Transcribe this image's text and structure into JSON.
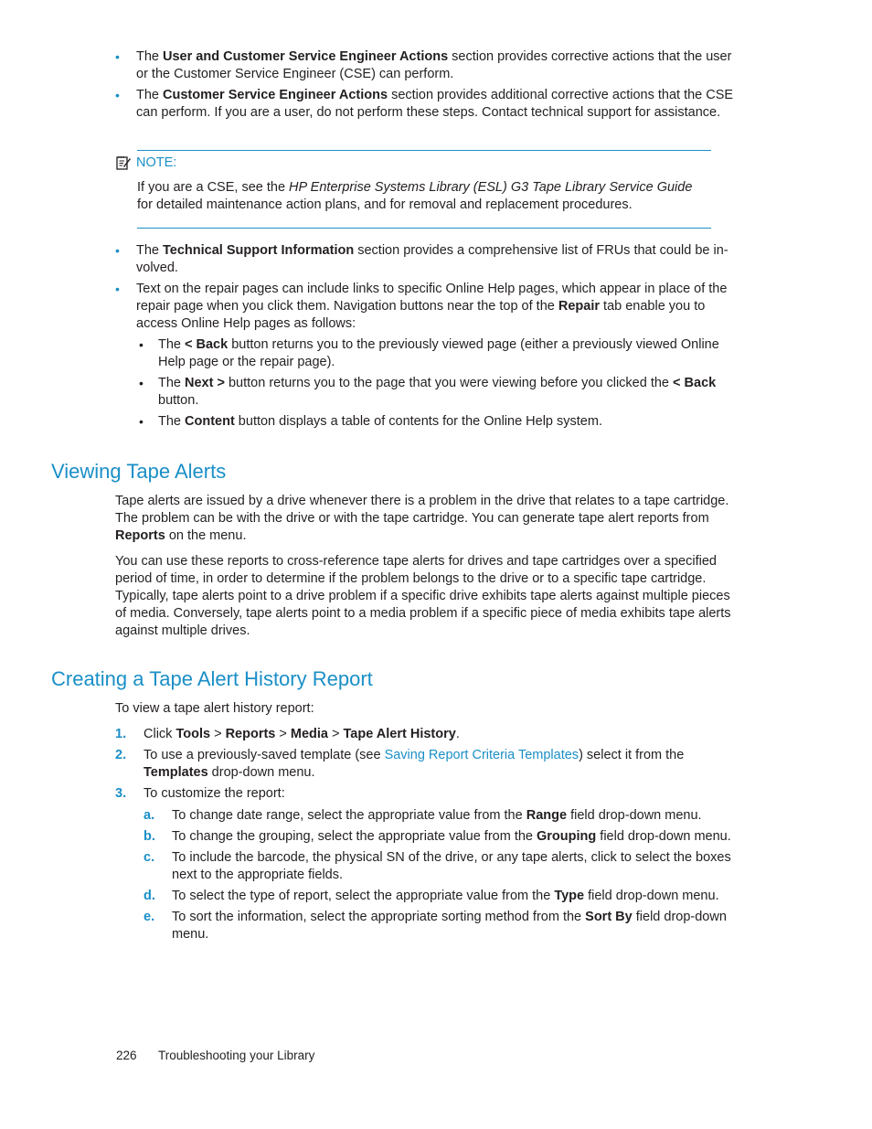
{
  "top_bullets": [
    {
      "pre": "The ",
      "bold": "User and Customer Service Engineer Actions",
      "post": " section provides corrective actions that the user or the Customer Service Engineer (CSE) can perform."
    },
    {
      "pre": "The ",
      "bold": "Customer Service Engineer Actions",
      "post": " section provides additional corrective actions that the CSE can perform. If you are a user, do not perform these steps. Contact technical support for assistance."
    }
  ],
  "note": {
    "icon": "note-pad-icon",
    "label": "NOTE:",
    "pre": "If you are a CSE, see the ",
    "italic": "HP Enterprise Systems Library (ESL) G3 Tape Library Service Guide",
    "post": " for detailed maintenance action plans, and for removal and replacement procedures."
  },
  "mid_bullets": {
    "tech_support": {
      "pre": "The ",
      "bold": "Technical Support Information",
      "post": " section provides a comprehensive list of FRUs that could be in-volved."
    },
    "repair_pages": {
      "pre": "Text on the repair pages can include links to specific Online Help pages, which appear in place of the repair page when you click them. Navigation buttons near the top of the ",
      "bold": "Repair",
      "post": " tab enable you to access Online Help pages as follows:"
    },
    "nav_buttons": [
      {
        "pre": "The ",
        "bold": "< Back",
        "post": " button returns you to the previously viewed page (either a previously viewed Online Help page or the repair page).",
        "bold2": "",
        "post2": ""
      },
      {
        "pre": "The ",
        "bold": "Next >",
        "post": " button returns you to the page that you were viewing before you clicked the ",
        "bold2": "< Back",
        "post2": " button."
      },
      {
        "pre": "The ",
        "bold": "Content",
        "post": " button displays a table of contents for the Online Help system.",
        "bold2": "",
        "post2": ""
      }
    ]
  },
  "section_viewing": {
    "heading": "Viewing Tape Alerts",
    "p1_pre": "Tape alerts are issued by a drive whenever there is a problem in the drive that relates to a tape cartridge. The problem can be with the drive or with the tape cartridge. You can generate tape alert reports from ",
    "p1_bold": "Reports",
    "p1_post": " on the menu.",
    "p2": "You can use these reports to cross-reference tape alerts for drives and tape cartridges over a specified period of time, in order to determine if the problem belongs to the drive or to a specific tape cartridge. Typically, tape alerts point to a drive problem if a specific drive exhibits tape alerts against multiple pieces of media. Conversely, tape alerts point to a media problem if a specific piece of media exhibits tape alerts against multiple drives."
  },
  "section_creating": {
    "heading": "Creating a Tape Alert History Report",
    "intro": "To view a tape alert history report:",
    "step1": {
      "num": "1.",
      "pre": "Click ",
      "path": [
        "Tools",
        "Reports",
        "Media",
        "Tape Alert History"
      ],
      "sep": " > ",
      "post": "."
    },
    "step2": {
      "num": "2.",
      "pre": "To use a previously-saved template (see ",
      "link": "Saving Report Criteria Templates",
      "mid": ") select it from the ",
      "bold": "Templates",
      "post": " drop-down menu."
    },
    "step3": {
      "num": "3.",
      "text": "To customize the report:",
      "substeps": [
        {
          "num": "a.",
          "pre": "To change date range, select the appropriate value from the ",
          "bold": "Range",
          "post": " field drop-down menu."
        },
        {
          "num": "b.",
          "pre": "To change the grouping, select the appropriate value from the ",
          "bold": "Grouping",
          "post": " field drop-down menu."
        },
        {
          "num": "c.",
          "pre": "To include the barcode, the physical SN of the drive, or any tape alerts, click to select the boxes next to the appropriate fields.",
          "bold": "",
          "post": ""
        },
        {
          "num": "d.",
          "pre": "To select the type of report, select the appropriate value from the ",
          "bold": "Type",
          "post": " field drop-down menu."
        },
        {
          "num": "e.",
          "pre": "To sort the information, select the appropriate sorting method from the ",
          "bold": "Sort By",
          "post": " field drop-down menu."
        }
      ]
    }
  },
  "footer": {
    "page_number": "226",
    "chapter": "Troubleshooting your Library"
  },
  "colors": {
    "accent": "#1a8fc7",
    "text": "#231f20"
  }
}
